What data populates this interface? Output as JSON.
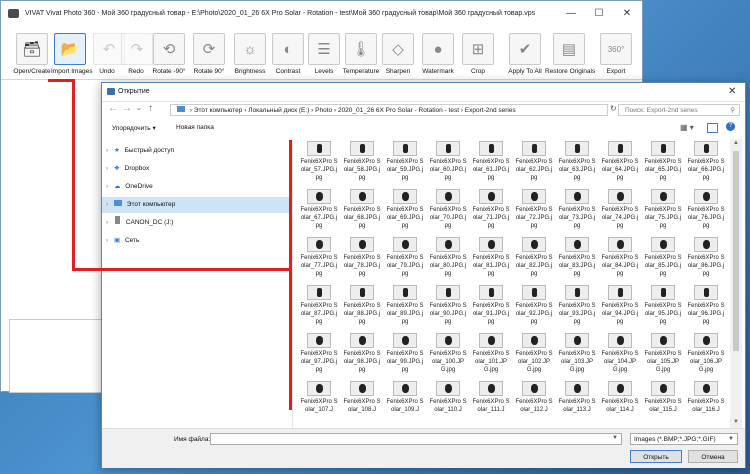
{
  "app": {
    "title": "VIVAT Vivat Photo 360 - Мой 360 градусный товар - E:\\Photo\\2020_01_26 6X Pro Solar - Rotation - test\\Мой 360 градусный товар\\Мой 360 градусный товар.vps",
    "toolbar": [
      {
        "label": "Open/Create",
        "icon": "folder-save-icon"
      },
      {
        "label": "Import Images",
        "icon": "folder-open-icon"
      },
      {
        "label": "Undo",
        "icon": "undo-icon"
      },
      {
        "label": "Redo",
        "icon": "redo-icon"
      },
      {
        "label": "Rotate -90°",
        "icon": "rotate-left-icon"
      },
      {
        "label": "Rotate 90°",
        "icon": "rotate-right-icon"
      },
      {
        "label": "Brightness",
        "icon": "brightness-icon"
      },
      {
        "label": "Contrast",
        "icon": "contrast-icon"
      },
      {
        "label": "Levels",
        "icon": "levels-icon"
      },
      {
        "label": "Temperature",
        "icon": "thermometer-icon"
      },
      {
        "label": "Sharpen",
        "icon": "diamond-icon"
      },
      {
        "label": "Watermark",
        "icon": "watermark-icon"
      },
      {
        "label": "Crop",
        "icon": "crop-icon"
      },
      {
        "label": "Apply To All",
        "icon": "check-all-icon"
      },
      {
        "label": "Restore Originals",
        "icon": "restore-icon"
      },
      {
        "label": "Export",
        "icon": "export-360-icon",
        "badge": "360°"
      }
    ]
  },
  "dialog": {
    "title": "Открытие",
    "path": [
      "Этот компьютер",
      "Локальный диск (E:)",
      "Photo",
      "2020_01_26 6X Pro Solar - Rotation - test",
      "Export-2nd series"
    ],
    "search_placeholder": "Поиск: Export-2nd series",
    "organize": "Упорядочить ▾",
    "new_folder": "Новая папка",
    "nav": [
      "Быстрый доступ",
      "Dropbox",
      "OneDrive",
      "Этот компьютер",
      "CANON_DC (J:)",
      "Сеть"
    ],
    "files": [
      "Fenix6XPro Solar_57.JPG.jpg",
      "Fenix6XPro Solar_58.JPG.jpg",
      "Fenix6XPro Solar_59.JPG.jpg",
      "Fenix6XPro Solar_60.JPG.jpg",
      "Fenix6XPro Solar_61.JPG.jpg",
      "Fenix6XPro Solar_62.JPG.jpg",
      "Fenix6XPro Solar_63.JPG.jpg",
      "Fenix6XPro Solar_64.JPG.jpg",
      "Fenix6XPro Solar_65.JPG.jpg",
      "Fenix6XPro Solar_66.JPG.jpg",
      "Fenix6XPro Solar_67.JPG.jpg",
      "Fenix6XPro Solar_68.JPG.jpg",
      "Fenix6XPro Solar_69.JPG.jpg",
      "Fenix6XPro Solar_70.JPG.jpg",
      "Fenix6XPro Solar_71.JPG.jpg",
      "Fenix6XPro Solar_72.JPG.jpg",
      "Fenix6XPro Solar_73.JPG.jpg",
      "Fenix6XPro Solar_74.JPG.jpg",
      "Fenix6XPro Solar_75.JPG.jpg",
      "Fenix6XPro Solar_76.JPG.jpg",
      "Fenix6XPro Solar_77.JPG.jpg",
      "Fenix6XPro Solar_78.JPG.jpg",
      "Fenix6XPro Solar_79.JPG.jpg",
      "Fenix6XPro Solar_80.JPG.jpg",
      "Fenix6XPro Solar_81.JPG.jpg",
      "Fenix6XPro Solar_82.JPG.jpg",
      "Fenix6XPro Solar_83.JPG.jpg",
      "Fenix6XPro Solar_84.JPG.jpg",
      "Fenix6XPro Solar_85.JPG.jpg",
      "Fenix6XPro Solar_86.JPG.jpg",
      "Fenix6XPro Solar_87.JPG.jpg",
      "Fenix6XPro Solar_88.JPG.jpg",
      "Fenix6XPro Solar_89.JPG.jpg",
      "Fenix6XPro Solar_90.JPG.jpg",
      "Fenix6XPro Solar_91.JPG.jpg",
      "Fenix6XPro Solar_92.JPG.jpg",
      "Fenix6XPro Solar_93.JPG.jpg",
      "Fenix6XPro Solar_94.JPG.jpg",
      "Fenix6XPro Solar_95.JPG.jpg",
      "Fenix6XPro Solar_96.JPG.jpg",
      "Fenix6XPro Solar_97.JPG.jpg",
      "Fenix6XPro Solar_98.JPG.jpg",
      "Fenix6XPro Solar_99.JPG.jpg",
      "Fenix6XPro Solar_100.JPG.jpg",
      "Fenix6XPro Solar_101.JPG.jpg",
      "Fenix6XPro Solar_102.JPG.jpg",
      "Fenix6XPro Solar_103.JPG.jpg",
      "Fenix6XPro Solar_104.JPG.jpg",
      "Fenix6XPro Solar_105.JPG.jpg",
      "Fenix6XPro Solar_106.JPG.jpg",
      "Fenix6XPro Solar_107.J",
      "Fenix6XPro Solar_108.J",
      "Fenix6XPro Solar_109.J",
      "Fenix6XPro Solar_110.J",
      "Fenix6XPro Solar_111.J",
      "Fenix6XPro Solar_112.J",
      "Fenix6XPro Solar_113.J",
      "Fenix6XPro Solar_114.J",
      "Fenix6XPro Solar_115.J",
      "Fenix6XPro Solar_116.J"
    ],
    "filename_label": "Имя файла:",
    "filename_value": "",
    "filter": "Images (*.BMP;*.JPG;*.GIF)",
    "open_button": "Открыть",
    "cancel_button": "Отмена"
  }
}
